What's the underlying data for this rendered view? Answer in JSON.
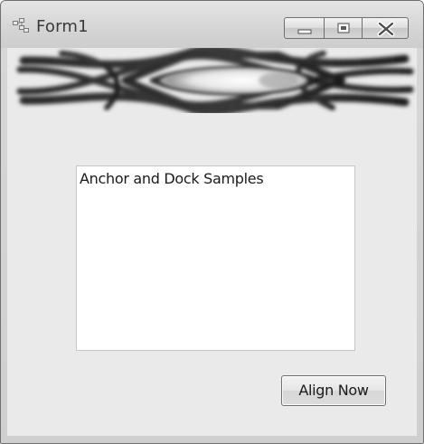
{
  "window": {
    "title": "Form1",
    "icon": "form-window-icon"
  },
  "caption_buttons": {
    "minimize_icon": "minimize-icon",
    "maximize_icon": "maximize-icon",
    "close_icon": "close-icon"
  },
  "banner": {
    "image": "star-chain-banner-image"
  },
  "textbox": {
    "text": "Anchor and Dock Samples"
  },
  "align_button": {
    "label": "Align Now"
  }
}
